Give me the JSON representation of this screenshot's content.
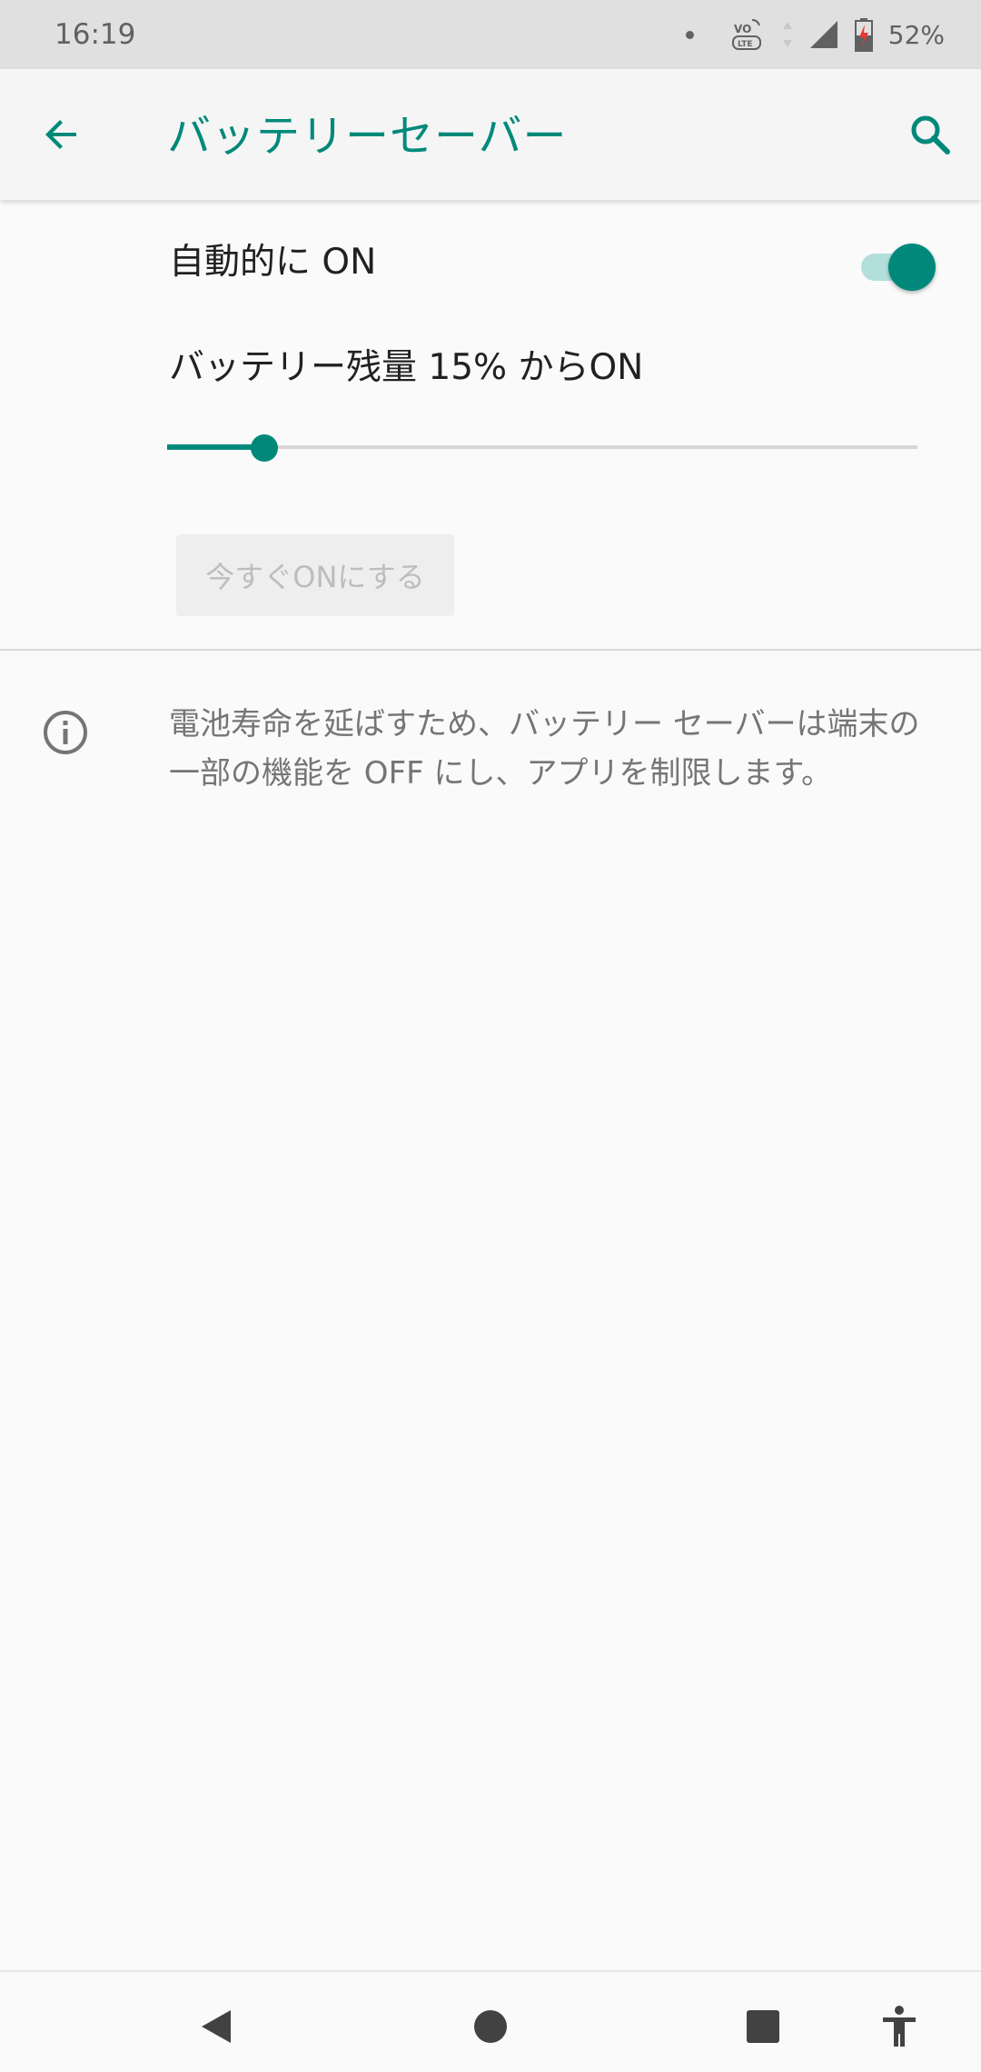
{
  "status_bar": {
    "time": "16:19",
    "battery_percent": "52%",
    "network": "VoLTE"
  },
  "app_bar": {
    "title": "バッテリーセーバー",
    "back_icon": "arrow-back-icon",
    "search_icon": "search-icon"
  },
  "settings": {
    "auto_on": {
      "label": "自動的に ON",
      "enabled": true
    },
    "threshold": {
      "label": "バッテリー残量 15% からON",
      "value_percent": 15,
      "max_percent": 75
    },
    "turn_on_now": {
      "label": "今すぐONにする",
      "disabled": true
    },
    "info": {
      "icon": "info-icon",
      "text": "電池寿命を延ばすため、バッテリー セーバーは端末の一部の機能を OFF にし、アプリを制限します。"
    }
  },
  "nav_bar": {
    "back_icon": "nav-back-icon",
    "home_icon": "nav-home-icon",
    "recents_icon": "nav-recents-icon",
    "accessibility_icon": "accessibility-icon"
  },
  "colors": {
    "accent": "#00897b",
    "accent_light": "#b2dfdb",
    "text_primary": "#212121",
    "text_secondary": "#757575"
  }
}
